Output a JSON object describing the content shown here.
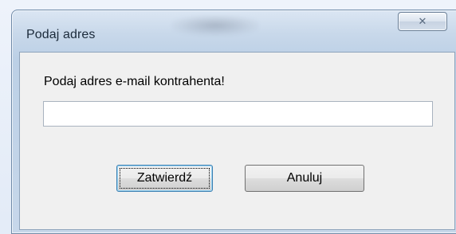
{
  "window": {
    "title": "Podaj adres"
  },
  "dialog": {
    "prompt": "Podaj adres e-mail kontrahenta!",
    "email_value": "",
    "email_placeholder": ""
  },
  "buttons": {
    "confirm_label": "Zatwierdź",
    "cancel_label": "Anuluj"
  },
  "icons": {
    "close": "close-icon"
  }
}
